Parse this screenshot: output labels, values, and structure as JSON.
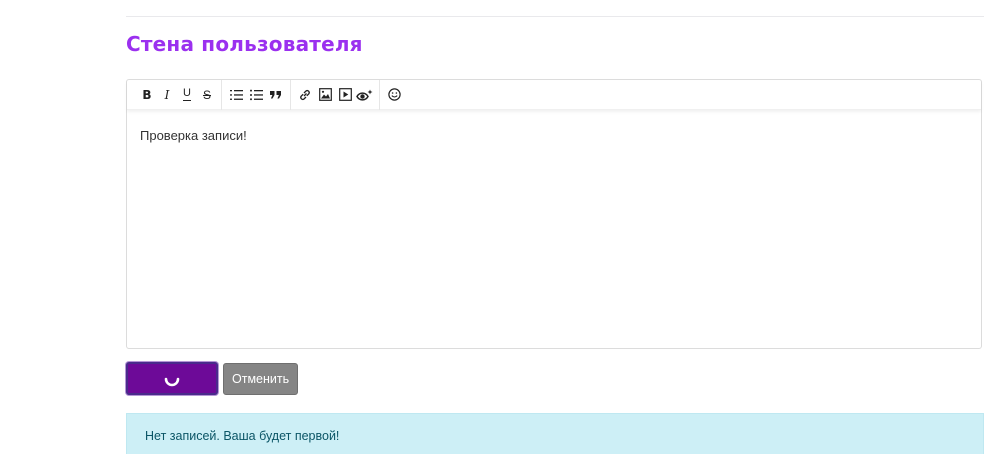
{
  "wall": {
    "title": "Стена пользователя"
  },
  "editor": {
    "toolbar": {
      "bold": "B",
      "italic": "I",
      "underline": "U",
      "strike": "S"
    },
    "content": "Проверка записи!"
  },
  "actions": {
    "cancel_label": "Отменить",
    "submit_state": "loading"
  },
  "alert": {
    "message": "Нет записей. Ваша будет первой!"
  },
  "colors": {
    "accent": "#9b30ef",
    "submit_bg": "#6d0a98",
    "cancel_bg": "#858585",
    "alert_bg": "#cdeff6",
    "alert_text": "#0b5566"
  },
  "icons": [
    "bold-icon",
    "italic-icon",
    "underline-icon",
    "strikethrough-icon",
    "ordered-list-icon",
    "unordered-list-icon",
    "quote-icon",
    "link-icon",
    "image-icon",
    "video-icon",
    "preview-icon",
    "emoji-icon",
    "loading-spinner-icon"
  ]
}
